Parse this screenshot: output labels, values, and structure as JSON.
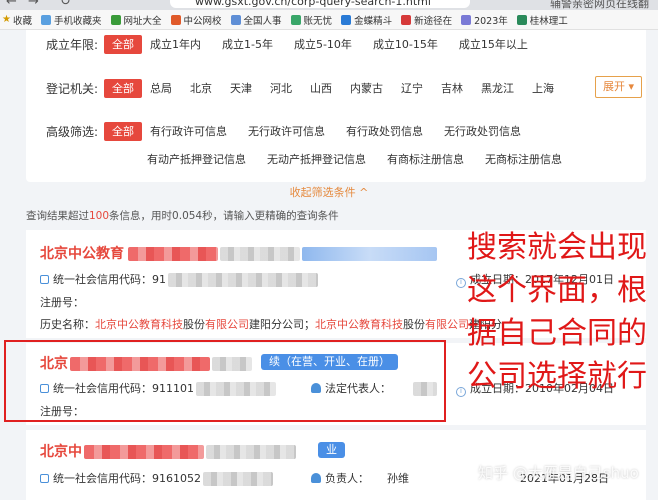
{
  "browser": {
    "url": "www.gsxt.gov.cn/corp-query-search-1.html",
    "right_text": "辅警亲密网页在线翻",
    "bookmarks": [
      {
        "label": "收藏",
        "color": "#d39a00"
      },
      {
        "label": "手机收藏夹",
        "color": "#5aa0e0"
      },
      {
        "label": "网址大全",
        "color": "#3a9b3a"
      },
      {
        "label": "中公网校",
        "color": "#e05a2a"
      },
      {
        "label": "全国人事",
        "color": "#5f8fd6"
      },
      {
        "label": "账无忧",
        "color": "#3aa76a"
      },
      {
        "label": "金蝶精斗",
        "color": "#2a7bd6"
      },
      {
        "label": "新途径在",
        "color": "#d63a3a"
      },
      {
        "label": "2023年",
        "color": "#7a7ad6"
      },
      {
        "label": "桂林理工",
        "color": "#2a8a5a"
      }
    ]
  },
  "filters": {
    "year": {
      "label": "成立年限:",
      "all": "全部",
      "options": [
        "成立1年内",
        "成立1-5年",
        "成立5-10年",
        "成立10-15年",
        "成立15年以上"
      ]
    },
    "authority": {
      "label": "登记机关:",
      "all": "全部",
      "options": [
        "总局",
        "北京",
        "天津",
        "河北",
        "山西",
        "内蒙古",
        "辽宁",
        "吉林",
        "黑龙江",
        "上海"
      ],
      "expand": "展开 ▾"
    },
    "advanced": {
      "label": "高级筛选:",
      "all": "全部",
      "row1": [
        "有行政许可信息",
        "无行政许可信息",
        "有行政处罚信息",
        "无行政处罚信息"
      ],
      "row2": [
        "有动产抵押登记信息",
        "无动产抵押登记信息",
        "有商标注册信息",
        "无商标注册信息"
      ]
    },
    "collapse": "收起筛选条件 ^"
  },
  "summary": {
    "prefix": "查询结果超过",
    "count": "100",
    "suffix": "条信息，用时0.054秒，请输入更精确的查询条件"
  },
  "cards": [
    {
      "name": "北京中公教育",
      "credit_label": "统一社会信用代码：",
      "credit_value": "91",
      "date_label": "成立日期：",
      "date_value": "2017年12月01日",
      "reg_label": "注册号：",
      "history_label": "历史名称：",
      "history_a": "北京中公教育科技",
      "history_b": "股份",
      "history_c": "有限公司",
      "history_d": "建阳分公司；",
      "history_e": "北京中公教育科技",
      "history_f": "股份",
      "history_g": "有限公司",
      "history_h": "建阳分"
    },
    {
      "name": "北京",
      "status": "续（在营、开业、在册）",
      "credit_label": "统一社会信用代码：",
      "credit_value": "911101",
      "rep_label": "法定代表人：",
      "date_label": "成立日期：",
      "date_value": "2010年02月04日",
      "reg_label": "注册号："
    },
    {
      "name": "北京中",
      "status": "业",
      "credit_label": "统一社会信用代码：",
      "credit_value": "9161052",
      "rep_label": "负责人：",
      "rep_value": "孙维",
      "date_value": "2021年01月28日"
    }
  ],
  "annotation": "搜索就会出现这个界面，根据自己合同的公司选择就行",
  "watermark": "知乎 @大雁是自己shuo"
}
